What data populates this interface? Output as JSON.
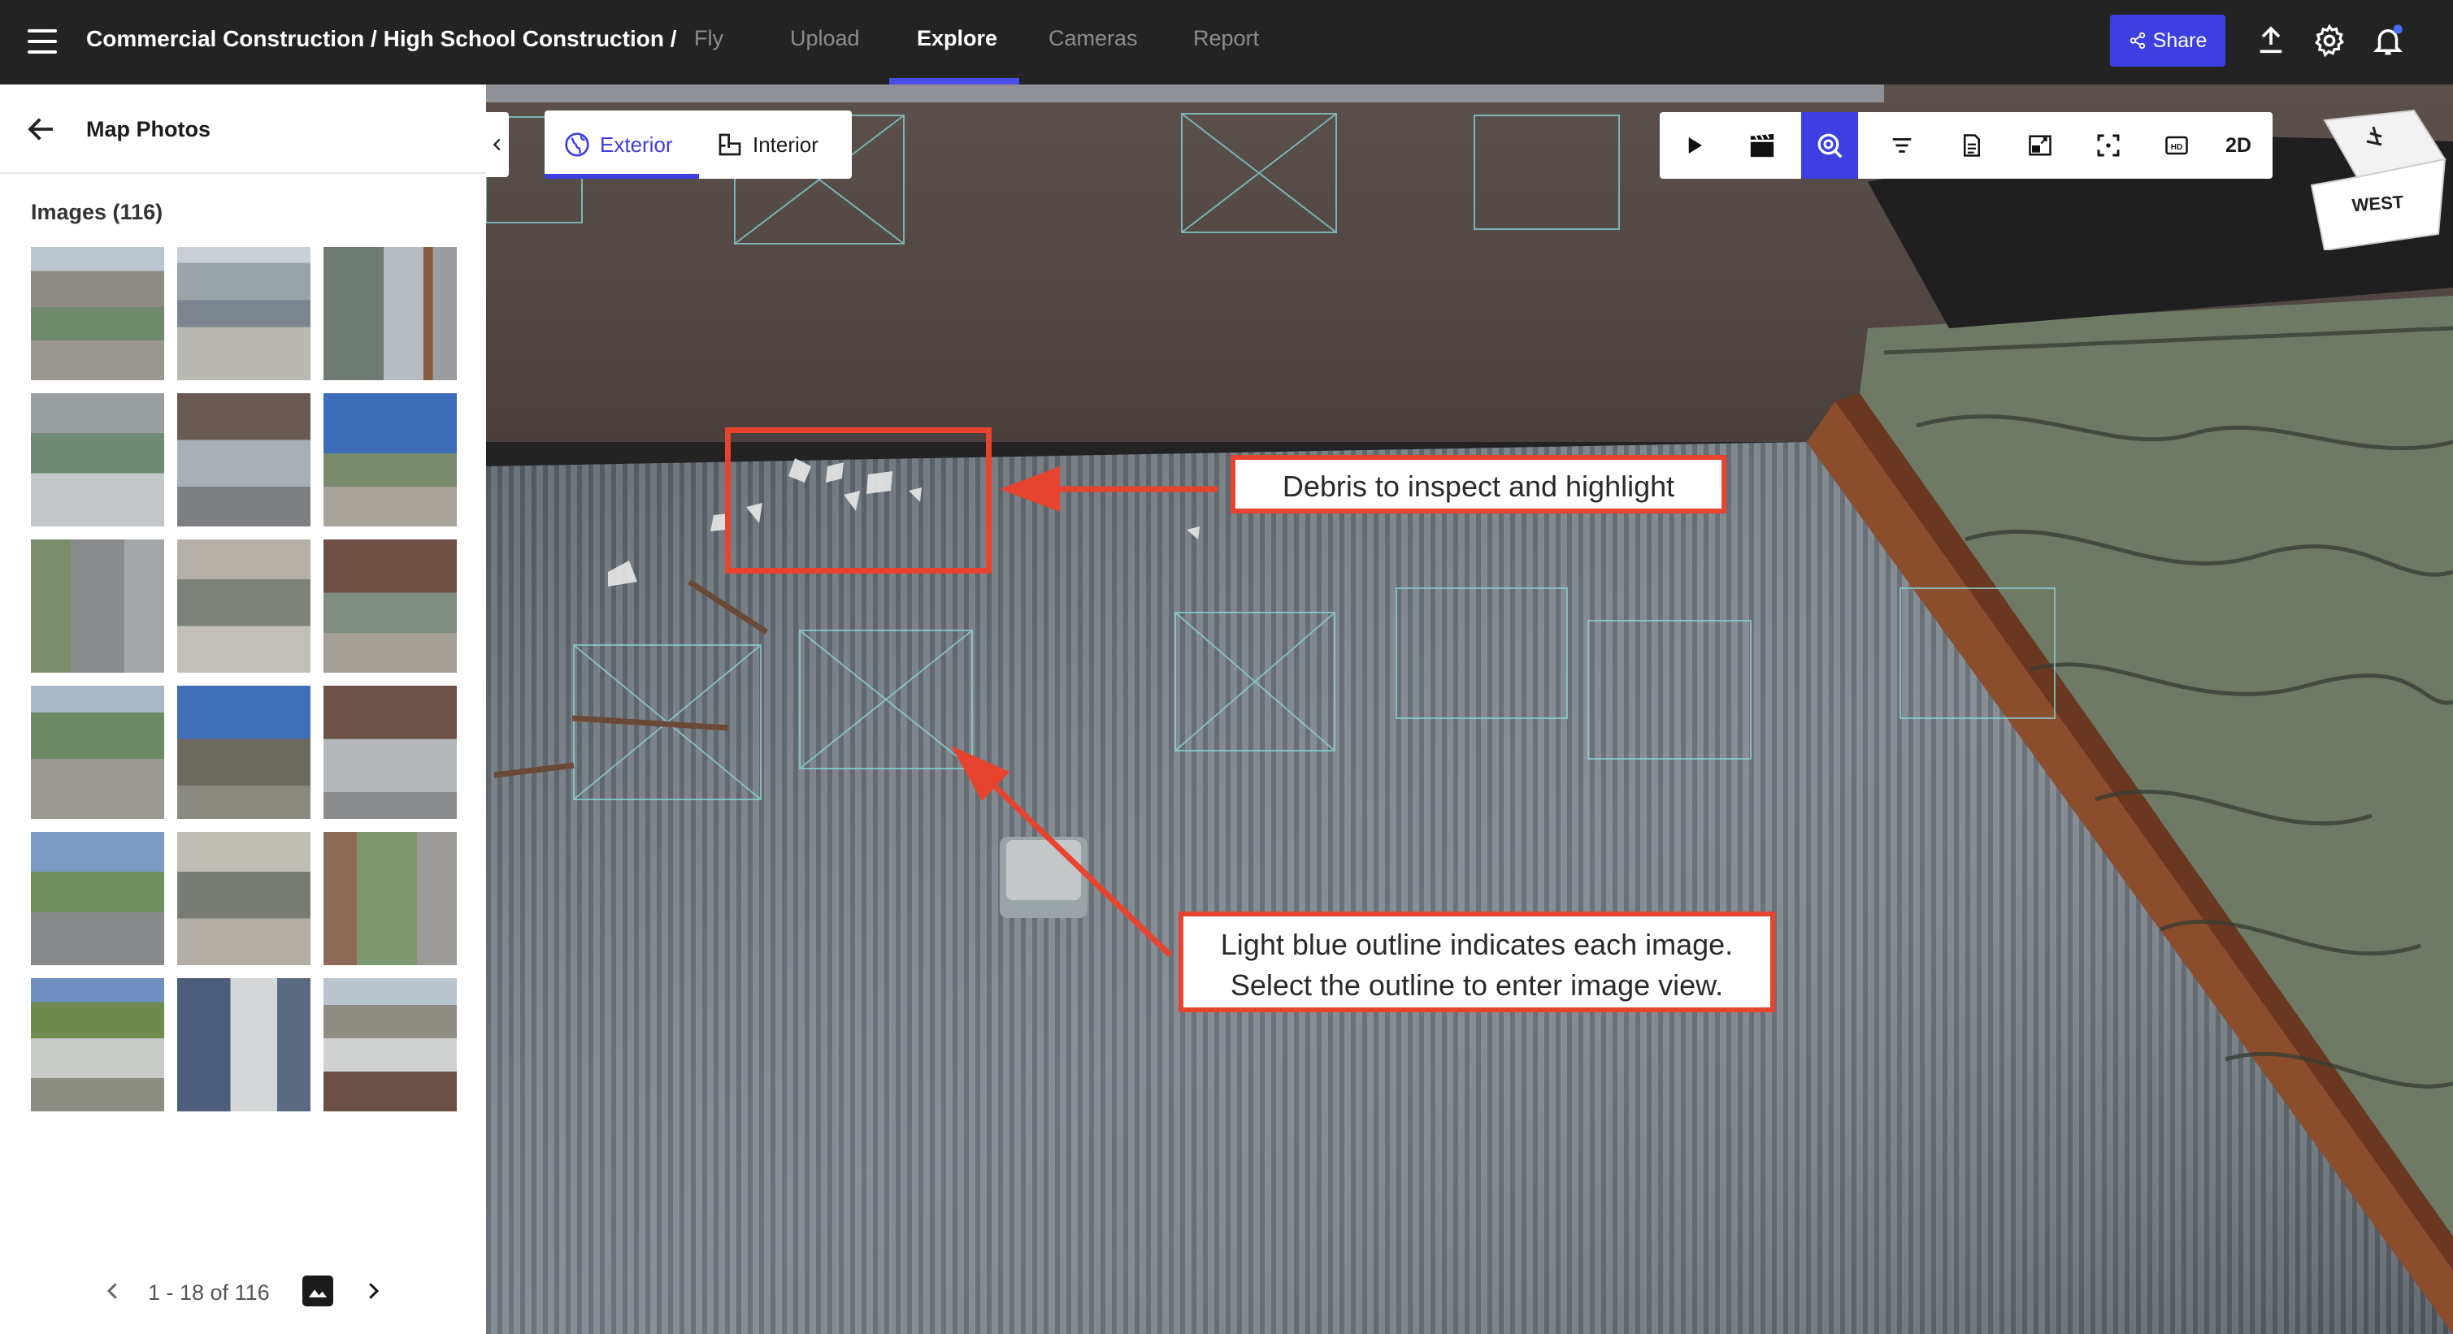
{
  "header": {
    "breadcrumb": "Commercial Construction / High School Construction /",
    "tabs": [
      {
        "label": "Fly",
        "active": false
      },
      {
        "label": "Upload",
        "active": false
      },
      {
        "label": "Explore",
        "active": true
      },
      {
        "label": "Cameras",
        "active": false
      },
      {
        "label": "Report",
        "active": false
      }
    ],
    "share_label": "Share",
    "accent": "#3d3fe0",
    "notification_dot": "#4a6cf7"
  },
  "sidebar": {
    "title": "Map Photos",
    "image_count_label": "Images (116)",
    "pagination": "1 - 18 of 116"
  },
  "viewport": {
    "view_toggle": {
      "exterior_label": "Exterior",
      "interior_label": "Interior",
      "selected": "Exterior"
    },
    "toolbar_2d_label": "2D",
    "toolbar_icons": [
      "play-icon",
      "clapper-icon",
      "zoom-search-icon",
      "filter-icon",
      "document-icon",
      "minimap-icon",
      "fullscreen-icon",
      "hd-icon"
    ],
    "compass_label": "WEST",
    "annotations": {
      "debris": "Debris to inspect and highlight",
      "outline_line1": "Light blue outline indicates each image.",
      "outline_line2": "Select the outline to enter image view."
    },
    "annotation_color": "#e8432e"
  }
}
